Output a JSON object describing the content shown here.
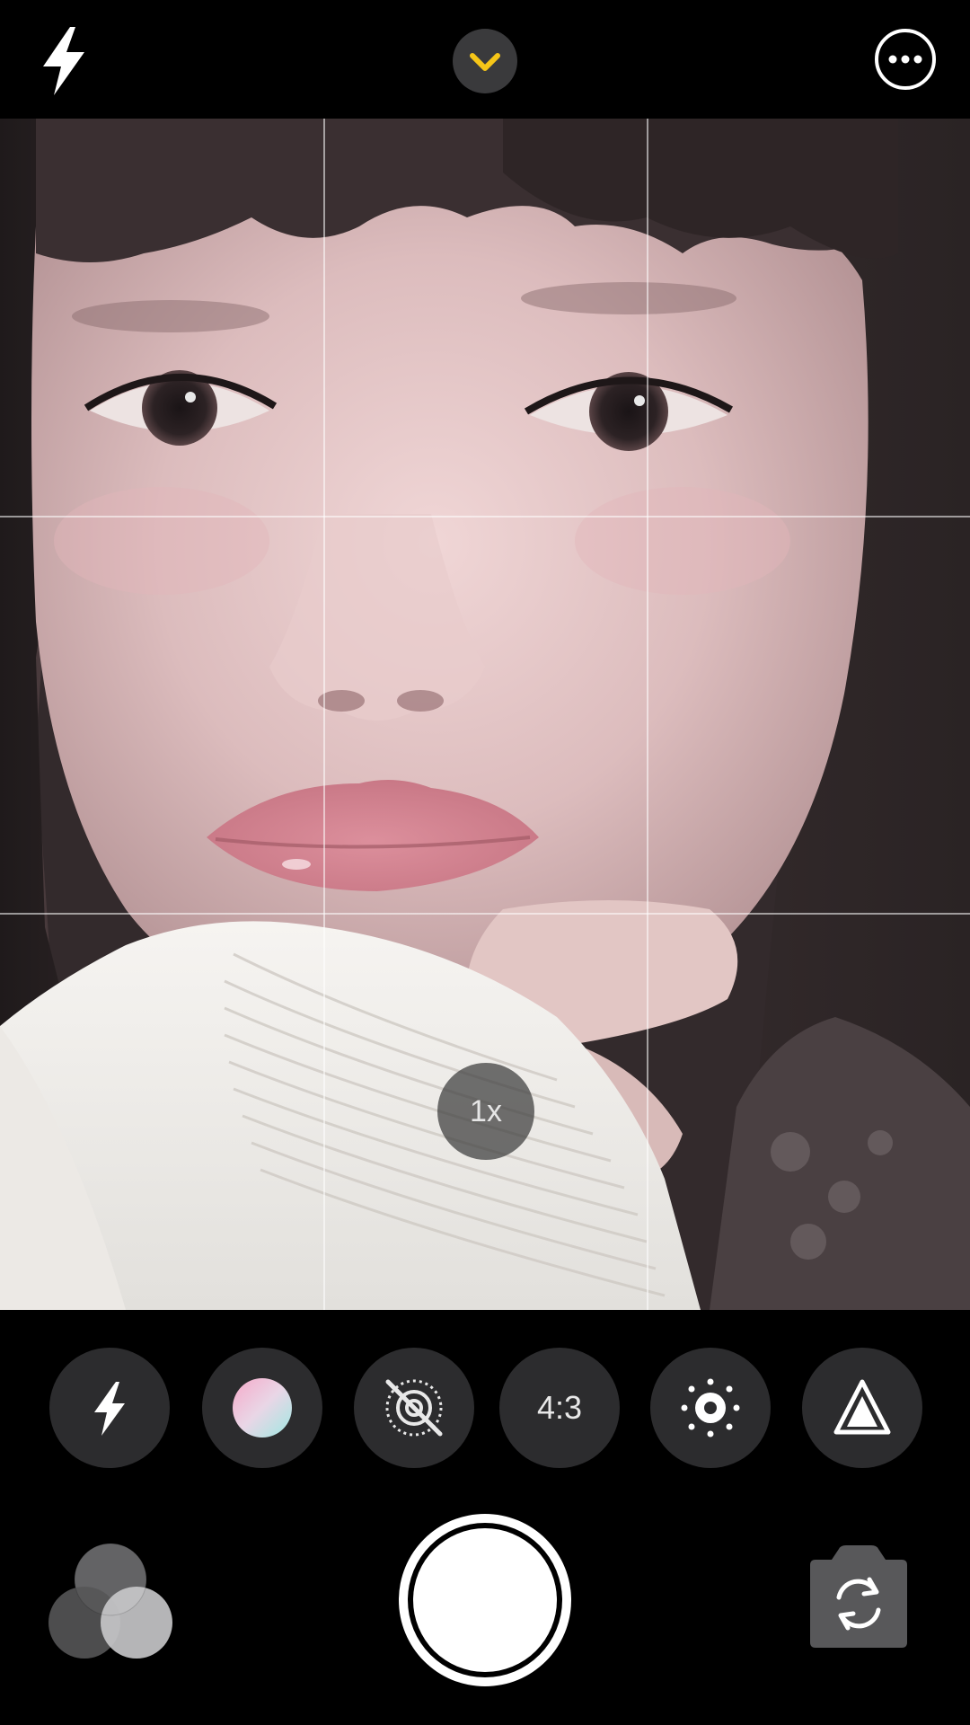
{
  "top_bar": {
    "flash_icon": "flash-icon",
    "collapse_icon": "chevron-down-icon",
    "more_icon": "more-icon",
    "accent_color": "#f5c518"
  },
  "viewfinder": {
    "grid": "3x3",
    "zoom_label": "1x"
  },
  "options": [
    {
      "icon": "flash-icon",
      "label": ""
    },
    {
      "icon": "color-filter-icon",
      "label": ""
    },
    {
      "icon": "live-photo-off-icon",
      "label": ""
    },
    {
      "icon": "aspect-ratio",
      "label": "4:3"
    },
    {
      "icon": "exposure-icon",
      "label": ""
    },
    {
      "icon": "sharpness-icon",
      "label": ""
    }
  ],
  "bottom_bar": {
    "filters_icon": "filters-icon",
    "shutter": "shutter-button",
    "flip_icon": "camera-flip-icon"
  }
}
